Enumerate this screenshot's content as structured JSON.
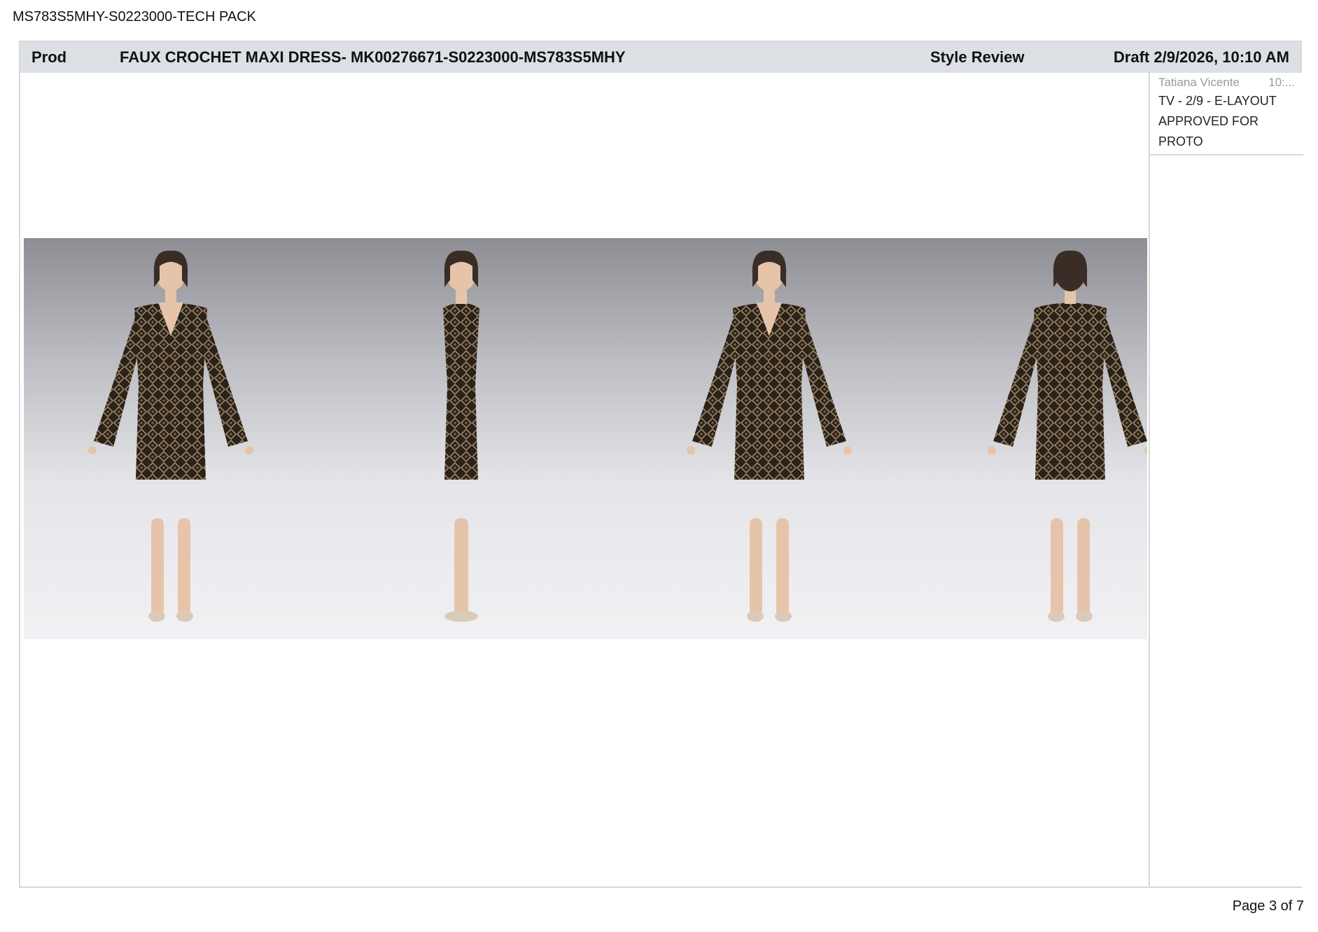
{
  "document": {
    "title": "MS783S5MHY-S0223000-TECH PACK",
    "page_label": "Page 3 of 7"
  },
  "header": {
    "category": "Prod",
    "style_title": "FAUX CROCHET MAXI DRESS- MK00276671-S0223000-MS783S5MHY",
    "stage": "Style Review",
    "status": "Draft 2/9/2026, 10:10 AM"
  },
  "comment": {
    "author": "Tatiana Vicente",
    "time": "10:...",
    "text": "TV - 2/9 - E-LAYOUT APPROVED FOR PROTO"
  },
  "image": {
    "subject": "3D avatar renders of crochet-pattern dress",
    "views": [
      "front",
      "side",
      "three-quarter",
      "back"
    ],
    "colors": {
      "fabric": "#2b2219",
      "pattern": "#9c8566",
      "skin": "#e6c4aa",
      "hair": "#3a2d26",
      "shoes": "#d9cbb8"
    }
  }
}
